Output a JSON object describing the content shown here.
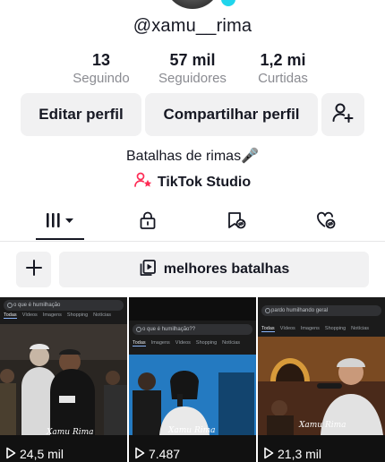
{
  "profile": {
    "username": "@xamu__rima",
    "bio": "Batalhas de rimas🎤",
    "studio_link": "TikTok Studio"
  },
  "stats": [
    {
      "value": "13",
      "label": "Seguindo"
    },
    {
      "value": "57 mil",
      "label": "Seguidores"
    },
    {
      "value": "1,2 mi",
      "label": "Curtidas"
    }
  ],
  "actions": {
    "edit_profile": "Editar perfil",
    "share_profile": "Compartilhar perfil"
  },
  "playlist": {
    "label": "melhores batalhas"
  },
  "videos": [
    {
      "search": "o que é humilhação",
      "tabs": [
        "Todas",
        "Vídeos",
        "Imagens",
        "Shopping",
        "Notícias"
      ],
      "watermark": "Xamu Rima",
      "views": "24,5 mil"
    },
    {
      "search": "o que é humilhação??",
      "tabs": [
        "Todas",
        "Imagens",
        "Vídeos",
        "Shopping",
        "Notícias"
      ],
      "watermark": "Xamu Rima",
      "views": "7.487"
    },
    {
      "search": "pardo humilhando geral",
      "tabs": [
        "Todas",
        "Vídeos",
        "Imagens",
        "Shopping",
        "Notícias"
      ],
      "watermark": "Xamu Rima",
      "views": "21,3 mil"
    }
  ],
  "colors": {
    "text": "#161823",
    "muted": "#8a8b91",
    "button_bg": "#f1f1f2",
    "studio_accent": "#fe2c55",
    "avatar_badge": "#20d5ec"
  }
}
